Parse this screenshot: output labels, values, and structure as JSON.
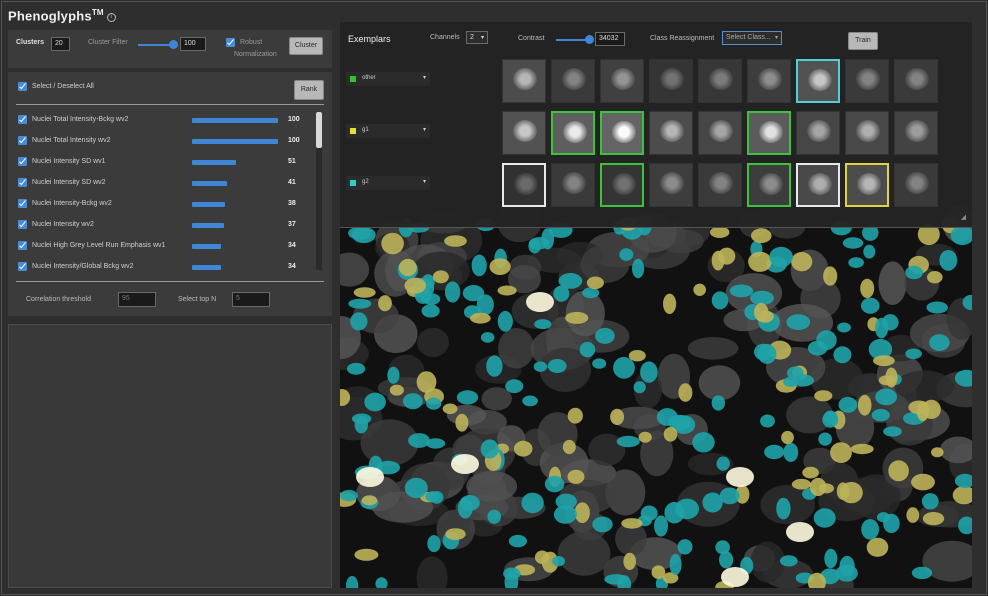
{
  "app": {
    "title": "Phenoglyphs",
    "title_sup": "TM",
    "info_icon": "info-icon"
  },
  "controls": {
    "clusters_label": "Clusters",
    "clusters_value": "20",
    "cluster_filter_label": "Cluster Filter",
    "cluster_filter_value": "100",
    "robust_label": "Robust",
    "normalization_label": "Normalization",
    "cluster_button": "Cluster"
  },
  "features": {
    "select_all_label": "Select / Deselect All",
    "rank_button": "Rank",
    "items": [
      {
        "name": "Nuclei Total Intensity-Bckg wv2",
        "value": "100",
        "fraction": 1.0
      },
      {
        "name": "Nuclei Total Intensity wv2",
        "value": "100",
        "fraction": 1.0
      },
      {
        "name": "Nuclei Intensity SD wv1",
        "value": "51",
        "fraction": 0.51
      },
      {
        "name": "Nuclei Intensity SD wv2",
        "value": "41",
        "fraction": 0.41
      },
      {
        "name": "Nuclei Intensity-Bckg wv2",
        "value": "38",
        "fraction": 0.38
      },
      {
        "name": "Nuclei Intensity wv2",
        "value": "37",
        "fraction": 0.37
      },
      {
        "name": "Nuclei High Grey Level Run Emphasis wv1",
        "value": "34",
        "fraction": 0.34
      },
      {
        "name": "Nuclei Intensity/Global Bckg wv2",
        "value": "34",
        "fraction": 0.34
      }
    ],
    "correlation_label": "Correlation threshold",
    "correlation_value": "95",
    "select_top_label": "Select top N",
    "select_top_value": "5"
  },
  "exemplars": {
    "title": "Exemplars",
    "channels_label": "Channels",
    "channels_value": "2",
    "contrast_label": "Contrast",
    "contrast_value": "34032",
    "reassign_label": "Class Reassignment",
    "reassign_placeholder": "Select Class...",
    "train_button": "Train",
    "classes": [
      {
        "name": "other",
        "color": "#2fc52f"
      },
      {
        "name": "g1",
        "color": "#e8e030"
      },
      {
        "name": "g2",
        "color": "#2ad0d0"
      }
    ]
  },
  "colors": {
    "accent": "#3f87d6",
    "cyan_cells": "#1fa3a8",
    "yellow_cells": "#bdb35a"
  }
}
